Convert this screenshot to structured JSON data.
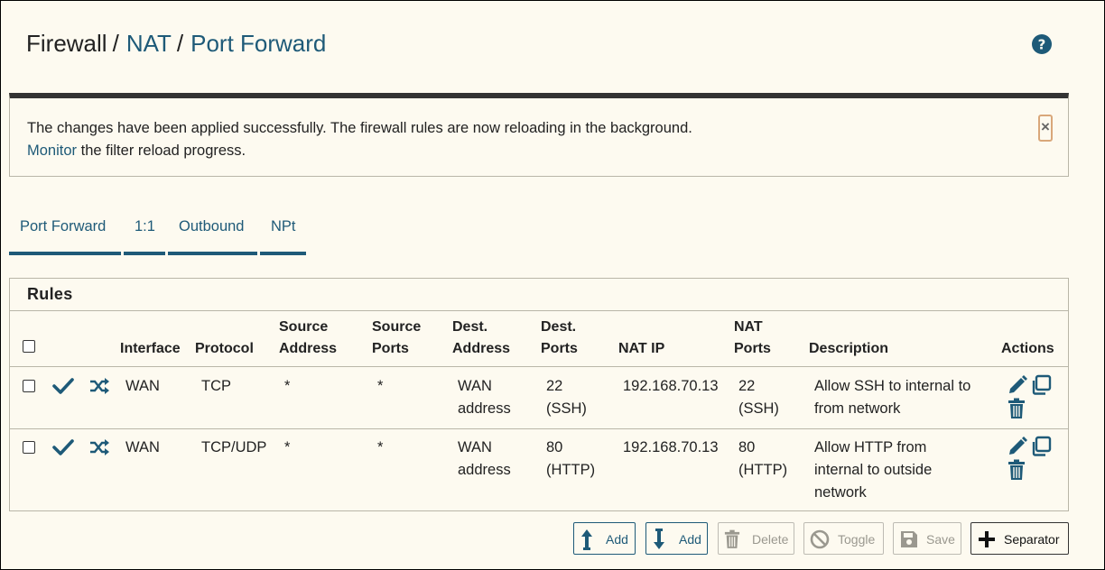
{
  "breadcrumb": {
    "root": "Firewall",
    "sep": "/",
    "level1": "NAT",
    "level2": "Port Forward"
  },
  "alert": {
    "message": "The changes have been applied successfully. The firewall rules are now reloading in the background.",
    "link_text": "Monitor",
    "link_suffix": " the filter reload progress.",
    "close_label": "×"
  },
  "tabs": [
    {
      "label": "Port Forward",
      "active": true
    },
    {
      "label": "1:1",
      "active": false
    },
    {
      "label": "Outbound",
      "active": false
    },
    {
      "label": "NPt",
      "active": false
    }
  ],
  "rules": {
    "title": "Rules",
    "headers": {
      "interface": "Interface",
      "protocol": "Protocol",
      "source_address_1": "Source",
      "source_address_2": "Address",
      "source_ports_1": "Source",
      "source_ports_2": "Ports",
      "dest_address_1": "Dest.",
      "dest_address_2": "Address",
      "dest_ports_1": "Dest.",
      "dest_ports_2": "Ports",
      "nat_ip": "NAT IP",
      "nat_ports_1": "NAT",
      "nat_ports_2": "Ports",
      "description": "Description",
      "actions": "Actions"
    },
    "rows": [
      {
        "interface": "WAN",
        "protocol": "TCP",
        "source_address": "*",
        "source_ports": "*",
        "dest_address_1": "WAN",
        "dest_address_2": "address",
        "dest_ports_1": "22",
        "dest_ports_2": "(SSH)",
        "nat_ip": "192.168.70.13",
        "nat_ports_1": "22",
        "nat_ports_2": "(SSH)",
        "description_1": "Allow SSH to internal to",
        "description_2": "from network",
        "description_3": ""
      },
      {
        "interface": "WAN",
        "protocol": "TCP/UDP",
        "source_address": "*",
        "source_ports": "*",
        "dest_address_1": "WAN",
        "dest_address_2": "address",
        "dest_ports_1": "80",
        "dest_ports_2": "(HTTP)",
        "nat_ip": "192.168.70.13",
        "nat_ports_1": "80",
        "nat_ports_2": "(HTTP)",
        "description_1": "Allow HTTP from",
        "description_2": "internal to outside",
        "description_3": "network"
      }
    ]
  },
  "buttons": {
    "add_top": "Add",
    "add_bottom": "Add",
    "delete": "Delete",
    "toggle": "Toggle",
    "save": "Save",
    "separator": "Separator"
  },
  "colors": {
    "accent": "#1e5a78",
    "background": "#fdfaf0",
    "border": "#b9b6a8"
  }
}
